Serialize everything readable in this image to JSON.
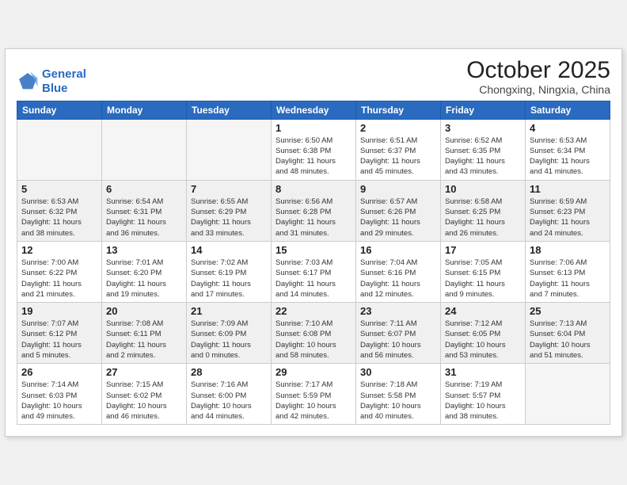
{
  "header": {
    "logo_line1": "General",
    "logo_line2": "Blue",
    "month": "October 2025",
    "location": "Chongxing, Ningxia, China"
  },
  "weekdays": [
    "Sunday",
    "Monday",
    "Tuesday",
    "Wednesday",
    "Thursday",
    "Friday",
    "Saturday"
  ],
  "weeks": [
    {
      "shaded": false,
      "days": [
        {
          "num": "",
          "info": ""
        },
        {
          "num": "",
          "info": ""
        },
        {
          "num": "",
          "info": ""
        },
        {
          "num": "1",
          "info": "Sunrise: 6:50 AM\nSunset: 6:38 PM\nDaylight: 11 hours\nand 48 minutes."
        },
        {
          "num": "2",
          "info": "Sunrise: 6:51 AM\nSunset: 6:37 PM\nDaylight: 11 hours\nand 45 minutes."
        },
        {
          "num": "3",
          "info": "Sunrise: 6:52 AM\nSunset: 6:35 PM\nDaylight: 11 hours\nand 43 minutes."
        },
        {
          "num": "4",
          "info": "Sunrise: 6:53 AM\nSunset: 6:34 PM\nDaylight: 11 hours\nand 41 minutes."
        }
      ]
    },
    {
      "shaded": true,
      "days": [
        {
          "num": "5",
          "info": "Sunrise: 6:53 AM\nSunset: 6:32 PM\nDaylight: 11 hours\nand 38 minutes."
        },
        {
          "num": "6",
          "info": "Sunrise: 6:54 AM\nSunset: 6:31 PM\nDaylight: 11 hours\nand 36 minutes."
        },
        {
          "num": "7",
          "info": "Sunrise: 6:55 AM\nSunset: 6:29 PM\nDaylight: 11 hours\nand 33 minutes."
        },
        {
          "num": "8",
          "info": "Sunrise: 6:56 AM\nSunset: 6:28 PM\nDaylight: 11 hours\nand 31 minutes."
        },
        {
          "num": "9",
          "info": "Sunrise: 6:57 AM\nSunset: 6:26 PM\nDaylight: 11 hours\nand 29 minutes."
        },
        {
          "num": "10",
          "info": "Sunrise: 6:58 AM\nSunset: 6:25 PM\nDaylight: 11 hours\nand 26 minutes."
        },
        {
          "num": "11",
          "info": "Sunrise: 6:59 AM\nSunset: 6:23 PM\nDaylight: 11 hours\nand 24 minutes."
        }
      ]
    },
    {
      "shaded": false,
      "days": [
        {
          "num": "12",
          "info": "Sunrise: 7:00 AM\nSunset: 6:22 PM\nDaylight: 11 hours\nand 21 minutes."
        },
        {
          "num": "13",
          "info": "Sunrise: 7:01 AM\nSunset: 6:20 PM\nDaylight: 11 hours\nand 19 minutes."
        },
        {
          "num": "14",
          "info": "Sunrise: 7:02 AM\nSunset: 6:19 PM\nDaylight: 11 hours\nand 17 minutes."
        },
        {
          "num": "15",
          "info": "Sunrise: 7:03 AM\nSunset: 6:17 PM\nDaylight: 11 hours\nand 14 minutes."
        },
        {
          "num": "16",
          "info": "Sunrise: 7:04 AM\nSunset: 6:16 PM\nDaylight: 11 hours\nand 12 minutes."
        },
        {
          "num": "17",
          "info": "Sunrise: 7:05 AM\nSunset: 6:15 PM\nDaylight: 11 hours\nand 9 minutes."
        },
        {
          "num": "18",
          "info": "Sunrise: 7:06 AM\nSunset: 6:13 PM\nDaylight: 11 hours\nand 7 minutes."
        }
      ]
    },
    {
      "shaded": true,
      "days": [
        {
          "num": "19",
          "info": "Sunrise: 7:07 AM\nSunset: 6:12 PM\nDaylight: 11 hours\nand 5 minutes."
        },
        {
          "num": "20",
          "info": "Sunrise: 7:08 AM\nSunset: 6:11 PM\nDaylight: 11 hours\nand 2 minutes."
        },
        {
          "num": "21",
          "info": "Sunrise: 7:09 AM\nSunset: 6:09 PM\nDaylight: 11 hours\nand 0 minutes."
        },
        {
          "num": "22",
          "info": "Sunrise: 7:10 AM\nSunset: 6:08 PM\nDaylight: 10 hours\nand 58 minutes."
        },
        {
          "num": "23",
          "info": "Sunrise: 7:11 AM\nSunset: 6:07 PM\nDaylight: 10 hours\nand 56 minutes."
        },
        {
          "num": "24",
          "info": "Sunrise: 7:12 AM\nSunset: 6:05 PM\nDaylight: 10 hours\nand 53 minutes."
        },
        {
          "num": "25",
          "info": "Sunrise: 7:13 AM\nSunset: 6:04 PM\nDaylight: 10 hours\nand 51 minutes."
        }
      ]
    },
    {
      "shaded": false,
      "days": [
        {
          "num": "26",
          "info": "Sunrise: 7:14 AM\nSunset: 6:03 PM\nDaylight: 10 hours\nand 49 minutes."
        },
        {
          "num": "27",
          "info": "Sunrise: 7:15 AM\nSunset: 6:02 PM\nDaylight: 10 hours\nand 46 minutes."
        },
        {
          "num": "28",
          "info": "Sunrise: 7:16 AM\nSunset: 6:00 PM\nDaylight: 10 hours\nand 44 minutes."
        },
        {
          "num": "29",
          "info": "Sunrise: 7:17 AM\nSunset: 5:59 PM\nDaylight: 10 hours\nand 42 minutes."
        },
        {
          "num": "30",
          "info": "Sunrise: 7:18 AM\nSunset: 5:58 PM\nDaylight: 10 hours\nand 40 minutes."
        },
        {
          "num": "31",
          "info": "Sunrise: 7:19 AM\nSunset: 5:57 PM\nDaylight: 10 hours\nand 38 minutes."
        },
        {
          "num": "",
          "info": ""
        }
      ]
    }
  ]
}
